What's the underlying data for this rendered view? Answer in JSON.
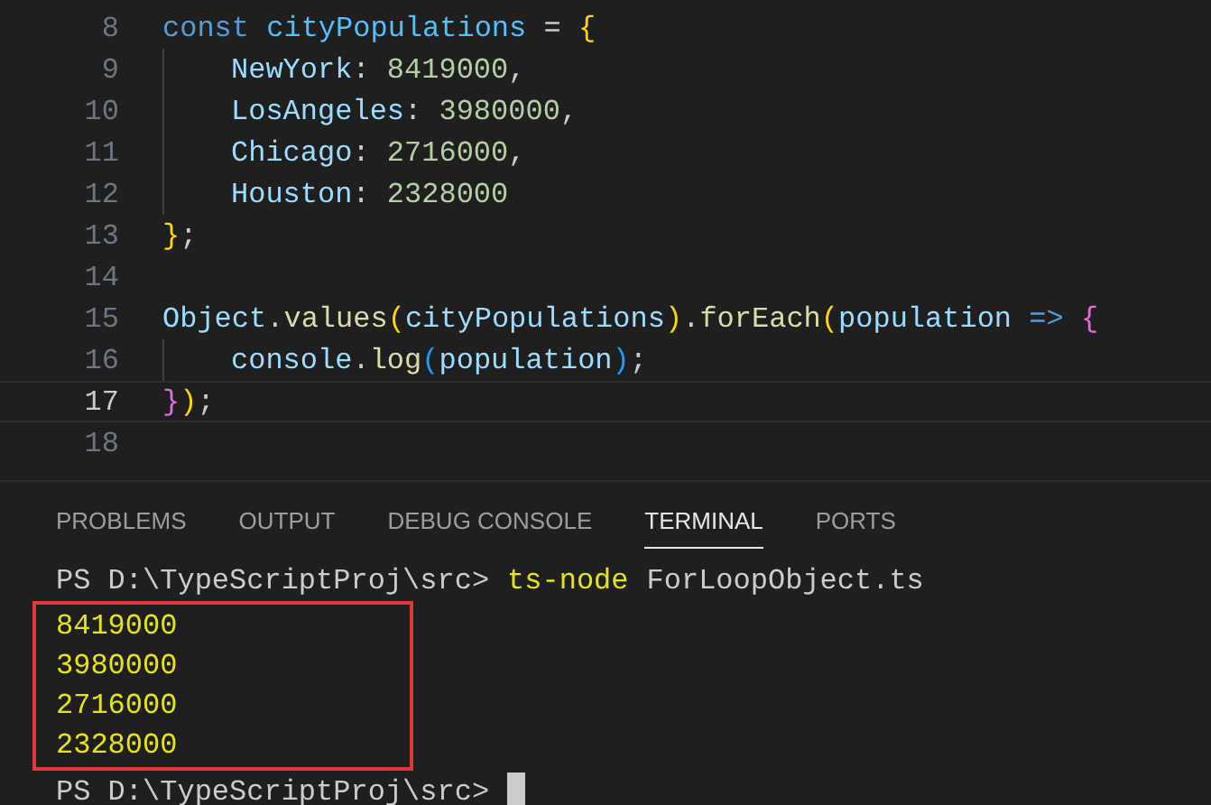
{
  "editor": {
    "lines": [
      {
        "number": "8",
        "current": false,
        "indented": false,
        "tokens": [
          {
            "kind": "keyword",
            "text": "const "
          },
          {
            "kind": "constant",
            "text": "cityPopulations"
          },
          {
            "kind": "punct",
            "text": " = "
          },
          {
            "kind": "brace1",
            "text": "{"
          }
        ]
      },
      {
        "number": "9",
        "current": false,
        "indented": true,
        "tokens": [
          {
            "kind": "property",
            "text": "NewYork"
          },
          {
            "kind": "punct",
            "text": ": "
          },
          {
            "kind": "number",
            "text": "8419000"
          },
          {
            "kind": "punct",
            "text": ","
          }
        ]
      },
      {
        "number": "10",
        "current": false,
        "indented": true,
        "tokens": [
          {
            "kind": "property",
            "text": "LosAngeles"
          },
          {
            "kind": "punct",
            "text": ": "
          },
          {
            "kind": "number",
            "text": "3980000"
          },
          {
            "kind": "punct",
            "text": ","
          }
        ]
      },
      {
        "number": "11",
        "current": false,
        "indented": true,
        "tokens": [
          {
            "kind": "property",
            "text": "Chicago"
          },
          {
            "kind": "punct",
            "text": ": "
          },
          {
            "kind": "number",
            "text": "2716000"
          },
          {
            "kind": "punct",
            "text": ","
          }
        ]
      },
      {
        "number": "12",
        "current": false,
        "indented": true,
        "tokens": [
          {
            "kind": "property",
            "text": "Houston"
          },
          {
            "kind": "punct",
            "text": ": "
          },
          {
            "kind": "number",
            "text": "2328000"
          }
        ]
      },
      {
        "number": "13",
        "current": false,
        "indented": false,
        "tokens": [
          {
            "kind": "brace1",
            "text": "}"
          },
          {
            "kind": "punct",
            "text": ";"
          }
        ]
      },
      {
        "number": "14",
        "current": false,
        "indented": false
      },
      {
        "number": "15",
        "current": false,
        "indented": false,
        "tokens": [
          {
            "kind": "property",
            "text": "Object"
          },
          {
            "kind": "punct",
            "text": "."
          },
          {
            "kind": "function",
            "text": "values"
          },
          {
            "kind": "brace1",
            "text": "("
          },
          {
            "kind": "property",
            "text": "cityPopulations"
          },
          {
            "kind": "brace1",
            "text": ")"
          },
          {
            "kind": "punct",
            "text": "."
          },
          {
            "kind": "function",
            "text": "forEach"
          },
          {
            "kind": "brace1",
            "text": "("
          },
          {
            "kind": "property",
            "text": "population "
          },
          {
            "kind": "keyword",
            "text": "=> "
          },
          {
            "kind": "brace2",
            "text": "{"
          }
        ]
      },
      {
        "number": "16",
        "current": false,
        "indented": true,
        "tokens": [
          {
            "kind": "property",
            "text": "console"
          },
          {
            "kind": "punct",
            "text": "."
          },
          {
            "kind": "function",
            "text": "log"
          },
          {
            "kind": "brace3",
            "text": "("
          },
          {
            "kind": "property",
            "text": "population"
          },
          {
            "kind": "brace3",
            "text": ")"
          },
          {
            "kind": "punct",
            "text": ";"
          }
        ]
      },
      {
        "number": "17",
        "current": true,
        "indented": false,
        "tokens": [
          {
            "kind": "brace2",
            "text": "}"
          },
          {
            "kind": "brace1",
            "text": ")"
          },
          {
            "kind": "punct",
            "text": ";"
          }
        ]
      },
      {
        "number": "18",
        "current": false,
        "indented": false
      }
    ]
  },
  "panel": {
    "tabs": [
      {
        "label": "PROBLEMS",
        "selected": false
      },
      {
        "label": "OUTPUT",
        "selected": false
      },
      {
        "label": "DEBUG CONSOLE",
        "selected": false
      },
      {
        "label": "TERMINAL",
        "selected": true
      },
      {
        "label": "PORTS",
        "selected": false
      }
    ],
    "terminal": {
      "prompt": "PS D:\\TypeScriptProj\\src>",
      "command": "ts-node",
      "argument": "ForLoopObject.ts",
      "output": {
        "highlighted": true,
        "lines": [
          "8419000",
          "3980000",
          "2716000",
          "2328000"
        ]
      },
      "final_prompt": "PS D:\\TypeScriptProj\\src>"
    }
  }
}
